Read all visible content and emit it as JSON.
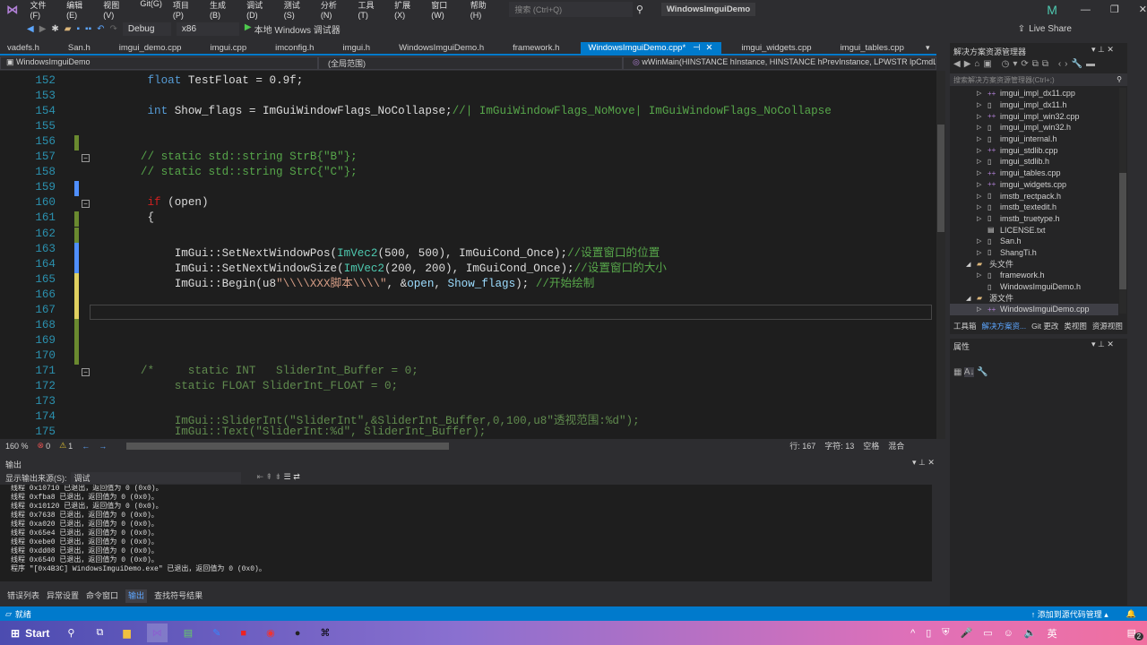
{
  "menu": [
    "文件(F)",
    "编辑(E)",
    "视图(V)",
    "Git(G)",
    "项目(P)",
    "生成(B)",
    "调试(D)",
    "测试(S)",
    "分析(N)",
    "工具(T)",
    "扩展(X)",
    "窗口(W)",
    "帮助(H)"
  ],
  "search_placeholder": "搜索 (Ctrl+Q)",
  "window_title": "WindowsImguiDemo",
  "user_initial": "M",
  "live_share": "Live Share",
  "toolbar": {
    "config": "Debug",
    "platform": "x86",
    "run": "本地 Windows 调试器"
  },
  "tabs": [
    "vadefs.h",
    "San.h",
    "imgui_demo.cpp",
    "imgui.cpp",
    "imconfig.h",
    "imgui.h",
    "WindowsImguiDemo.h",
    "framework.h",
    "WindowsImguiDemo.cpp*",
    "imgui_widgets.cpp",
    "imgui_tables.cpp"
  ],
  "active_tab": 8,
  "navbar": {
    "project": "WindowsImguiDemo",
    "scope": "(全局范围)",
    "member": "wWinMain(HINSTANCE hInstance, HINSTANCE hPrevInstance, LPWSTR lpCmdLine,"
  },
  "code": [
    {
      "n": "152",
      "t": [
        [
          "tx",
          "        "
        ],
        [
          "kw",
          "float"
        ],
        [
          "tx",
          " TestFloat = 0.9f;"
        ]
      ]
    },
    {
      "n": "153",
      "t": []
    },
    {
      "n": "154",
      "t": [
        [
          "tx",
          "        "
        ],
        [
          "kw",
          "int"
        ],
        [
          "tx",
          " Show_flags = ImGuiWindowFlags_NoCollapse;"
        ],
        [
          "cm",
          "//| ImGuiWindowFlags_NoMove| ImGuiWindowFlags_NoCollapse"
        ]
      ]
    },
    {
      "n": "155",
      "t": []
    },
    {
      "n": "156",
      "t": []
    },
    {
      "n": "157",
      "t": [
        [
          "cm",
          "       // static std::string StrB{\"B\"};"
        ]
      ]
    },
    {
      "n": "158",
      "t": [
        [
          "cm",
          "       // static std::string StrC{\"C\"};"
        ]
      ]
    },
    {
      "n": "159",
      "t": []
    },
    {
      "n": "160",
      "t": [
        [
          "tx",
          "        "
        ],
        [
          "red",
          "if"
        ],
        [
          "tx",
          " (open)"
        ]
      ]
    },
    {
      "n": "161",
      "t": [
        [
          "tx",
          "        {"
        ]
      ]
    },
    {
      "n": "162",
      "t": []
    },
    {
      "n": "163",
      "t": [
        [
          "tx",
          "            ImGui::SetNextWindowPos("
        ],
        [
          "ty",
          "ImVec2"
        ],
        [
          "tx",
          "(500, 500), ImGuiCond_Once);"
        ],
        [
          "cm",
          "//设置窗口的位置"
        ]
      ]
    },
    {
      "n": "164",
      "t": [
        [
          "tx",
          "            ImGui::SetNextWindowSize("
        ],
        [
          "ty",
          "ImVec2"
        ],
        [
          "tx",
          "(200, 200), ImGuiCond_Once);"
        ],
        [
          "cm",
          "//设置窗口的大小"
        ]
      ]
    },
    {
      "n": "165",
      "t": [
        [
          "tx",
          "            ImGui::Begin(u8"
        ],
        [
          "str",
          "\"\\\\\\\\XXX脚本\\\\\\\\\""
        ],
        [
          "tx",
          ", &"
        ],
        [
          "var",
          "open"
        ],
        [
          "tx",
          ", "
        ],
        [
          "var",
          "Show_flags"
        ],
        [
          "tx",
          "); "
        ],
        [
          "cm",
          "//开始绘制"
        ]
      ]
    },
    {
      "n": "166",
      "t": []
    },
    {
      "n": "167",
      "t": []
    },
    {
      "n": "168",
      "t": []
    },
    {
      "n": "169",
      "t": []
    },
    {
      "n": "170",
      "t": []
    },
    {
      "n": "171",
      "t": [
        [
          "cmt",
          "       /*     static INT   SliderInt_Buffer = 0;"
        ]
      ]
    },
    {
      "n": "172",
      "t": [
        [
          "cmt",
          "            static FLOAT SliderInt_FLOAT = 0;"
        ]
      ]
    },
    {
      "n": "173",
      "t": []
    },
    {
      "n": "174",
      "t": [
        [
          "cmt",
          "            ImGui::SliderInt(\"SliderInt\",&SliderInt_Buffer,0,100,u8\"透视范围:%d\");"
        ]
      ]
    },
    {
      "n": "175",
      "t": [
        [
          "cmt",
          "            ImGui::Text(\"SliderInt:%d\", SliderInt_Buffer);"
        ]
      ]
    }
  ],
  "editor_status": {
    "zoom": "160 %",
    "errors": "0",
    "warnings": "1",
    "line": "行: 167",
    "char": "字符: 13",
    "spaces": "空格",
    "eol": "混合"
  },
  "output": {
    "title": "输出",
    "source_label": "显示输出来源(S):",
    "source": "调试",
    "lines": [
      "线程 0x10710 已退出，返回值为 0 (0x0)。",
      "线程 0xfba8 已退出，返回值为 0 (0x0)。",
      "线程 0x10120 已退出，返回值为 0 (0x0)。",
      "线程 0x7638 已退出，返回值为 0 (0x0)。",
      "线程 0xa020 已退出，返回值为 0 (0x0)。",
      "线程 0x65e4 已退出，返回值为 0 (0x0)。",
      "线程 0xebe0 已退出，返回值为 0 (0x0)。",
      "线程 0xdd08 已退出，返回值为 0 (0x0)。",
      "线程 0x6540 已退出，返回值为 0 (0x0)。",
      "程序 \"[0x4B3C] WindowsImguiDemo.exe\" 已退出，返回值为 0 (0x0)。"
    ]
  },
  "bottom_tabs": [
    "错误列表",
    "异常设置",
    "命令窗口",
    "输出",
    "查找符号结果"
  ],
  "status": {
    "ready": "就绪",
    "source_control": "添加到源代码管理"
  },
  "solution": {
    "title": "解决方案资源管理器",
    "search": "搜索解决方案资源管理器(Ctrl+;)",
    "items": [
      {
        "label": "imgui_impl_dx11.cpp",
        "lvl": 2,
        "type": "cpp",
        "exp": "▷"
      },
      {
        "label": "imgui_impl_dx11.h",
        "lvl": 2,
        "type": "h",
        "exp": "▷"
      },
      {
        "label": "imgui_impl_win32.cpp",
        "lvl": 2,
        "type": "cpp",
        "exp": "▷"
      },
      {
        "label": "imgui_impl_win32.h",
        "lvl": 2,
        "type": "h",
        "exp": "▷"
      },
      {
        "label": "imgui_internal.h",
        "lvl": 2,
        "type": "h",
        "exp": "▷"
      },
      {
        "label": "imgui_stdlib.cpp",
        "lvl": 2,
        "type": "cpp",
        "exp": "▷"
      },
      {
        "label": "imgui_stdlib.h",
        "lvl": 2,
        "type": "h",
        "exp": "▷"
      },
      {
        "label": "imgui_tables.cpp",
        "lvl": 2,
        "type": "cpp",
        "exp": "▷"
      },
      {
        "label": "imgui_widgets.cpp",
        "lvl": 2,
        "type": "cpp",
        "exp": "▷"
      },
      {
        "label": "imstb_rectpack.h",
        "lvl": 2,
        "type": "h",
        "exp": "▷"
      },
      {
        "label": "imstb_textedit.h",
        "lvl": 2,
        "type": "h",
        "exp": "▷"
      },
      {
        "label": "imstb_truetype.h",
        "lvl": 2,
        "type": "h",
        "exp": "▷"
      },
      {
        "label": "LICENSE.txt",
        "lvl": 2,
        "type": "txt",
        "exp": ""
      },
      {
        "label": "San.h",
        "lvl": 2,
        "type": "h",
        "exp": "▷"
      },
      {
        "label": "ShangTi.h",
        "lvl": 2,
        "type": "h",
        "exp": "▷"
      },
      {
        "label": "头文件",
        "lvl": 1,
        "type": "folder",
        "exp": "◢"
      },
      {
        "label": "framework.h",
        "lvl": 2,
        "type": "h",
        "exp": "▷"
      },
      {
        "label": "WindowsImguiDemo.h",
        "lvl": 2,
        "type": "h",
        "exp": ""
      },
      {
        "label": "源文件",
        "lvl": 1,
        "type": "folder",
        "exp": "◢"
      },
      {
        "label": "WindowsImguiDemo.cpp",
        "lvl": 2,
        "type": "cpp",
        "exp": "▷",
        "selected": true
      }
    ],
    "tabs": [
      "工具箱",
      "解决方案资...",
      "Git 更改",
      "类视图",
      "资源视图"
    ]
  },
  "properties": {
    "title": "属性"
  },
  "taskbar": {
    "start": "Start",
    "notif_count": "2",
    "ime": "英"
  }
}
